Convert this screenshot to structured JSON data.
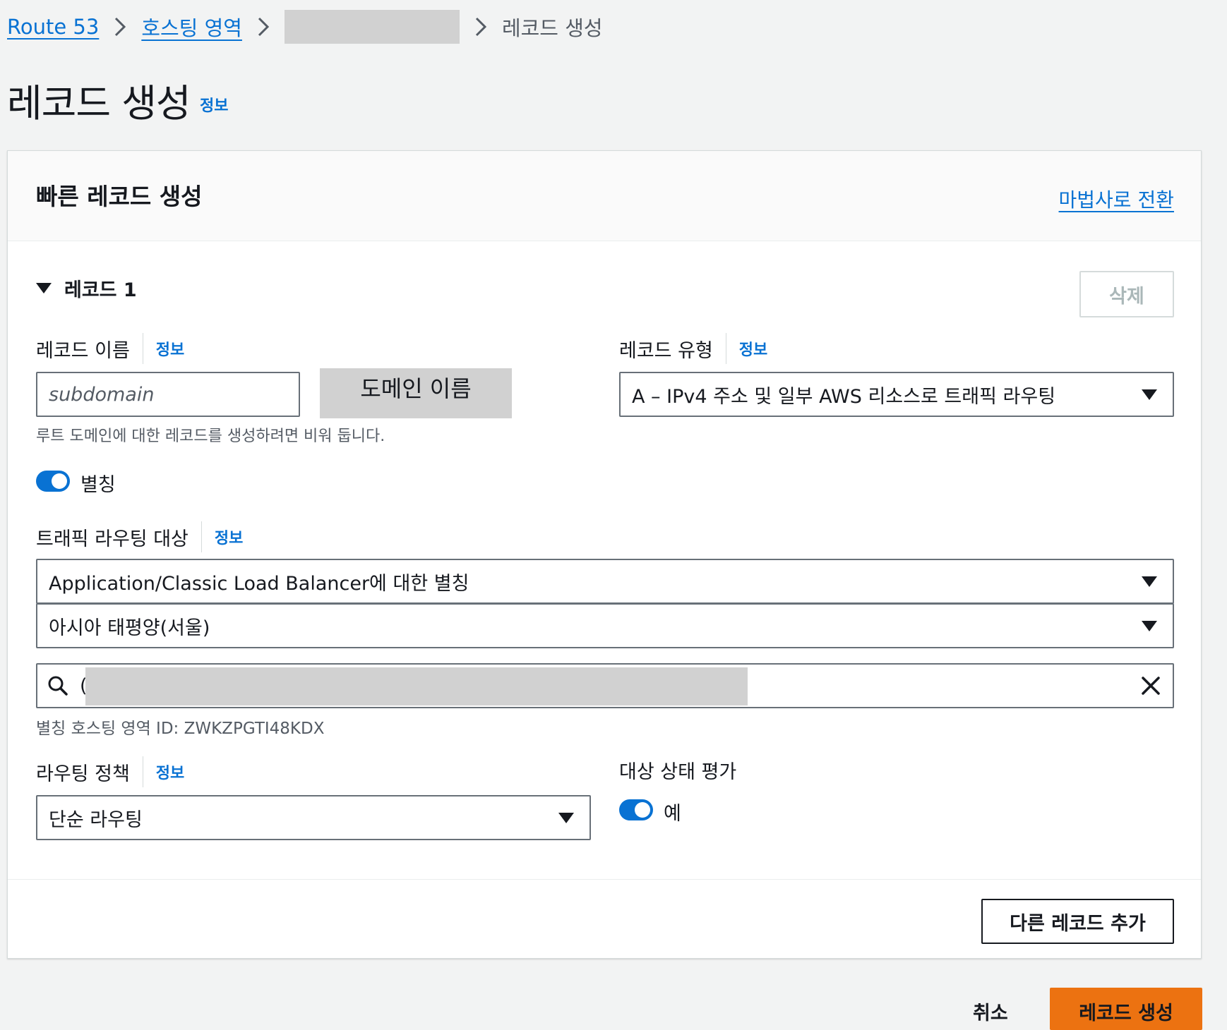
{
  "breadcrumb": {
    "root": "Route 53",
    "hosted_zones": "호스팅 영역",
    "current": "레코드 생성"
  },
  "page": {
    "title": "레코드 생성",
    "info": "정보"
  },
  "card": {
    "title": "빠른 레코드 생성",
    "wizard_link": "마법사로 전환"
  },
  "record": {
    "section_title": "레코드 1",
    "delete_label": "삭제",
    "name": {
      "label": "레코드 이름",
      "info": "정보",
      "placeholder": "subdomain",
      "domain_suffix": "도메인 이름",
      "hint": "루트 도메인에 대한 레코드를 생성하려면 비워 둡니다."
    },
    "type": {
      "label": "레코드 유형",
      "info": "정보",
      "value": "A – IPv4 주소 및 일부 AWS 리소스로 트래픽 라우팅"
    },
    "alias": {
      "label": "별칭",
      "enabled": true
    },
    "target": {
      "label": "트래픽 라우팅 대상",
      "info": "정보",
      "endpoint_type": "Application/Classic Load Balancer에 대한 별칭",
      "region": "아시아 태평양(서울)",
      "search_value": "(",
      "hosted_zone_hint": "별칭 호스팅 영역 ID: ZWKZPGTI48KDX"
    },
    "routing_policy": {
      "label": "라우팅 정책",
      "info": "정보",
      "value": "단순 라우팅"
    },
    "evaluate_health": {
      "label": "대상 상태 평가",
      "toggle_label": "예",
      "enabled": true
    }
  },
  "actions": {
    "add_record": "다른 레코드 추가",
    "cancel": "취소",
    "create": "레코드 생성"
  },
  "colors": {
    "link": "#0972d3",
    "primary": "#ec7211",
    "toggle_on": "#0972d3",
    "redaction": "#d1d1d1"
  }
}
